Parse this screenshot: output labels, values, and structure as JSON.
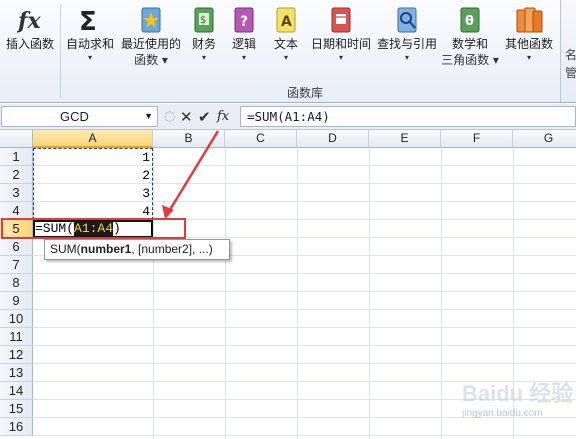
{
  "ribbon": {
    "buttons": [
      {
        "line1": "插入函数",
        "line2": "",
        "icon": "insert-function-icon"
      },
      {
        "line1": "自动求和",
        "line2": "▾",
        "icon": "sigma-icon"
      },
      {
        "line1": "最近使用的",
        "line2": "函数 ▾",
        "icon": "star-book-icon"
      },
      {
        "line1": "财务",
        "line2": "▾",
        "icon": "finance-book-icon"
      },
      {
        "line1": "逻辑",
        "line2": "▾",
        "icon": "logic-book-icon"
      },
      {
        "line1": "文本",
        "line2": "▾",
        "icon": "text-book-icon"
      },
      {
        "line1": "日期和时间",
        "line2": "▾",
        "icon": "calendar-book-icon"
      },
      {
        "line1": "查找与引用",
        "line2": "▾",
        "icon": "lookup-book-icon"
      },
      {
        "line1": "数学和",
        "line2": "三角函数 ▾",
        "icon": "math-book-icon"
      },
      {
        "line1": "其他函数",
        "line2": "▾",
        "icon": "more-functions-icon"
      }
    ],
    "group_label": "函数库",
    "cut_label_1": "名",
    "cut_label_2": "管"
  },
  "formula_bar": {
    "name_box": "GCD",
    "cancel": "✕",
    "enter": "✔",
    "fx": "fx",
    "formula": "=SUM(A1:A4)"
  },
  "grid": {
    "columns": [
      "A",
      "B",
      "C",
      "D",
      "E",
      "F",
      "G"
    ],
    "rows": [
      "1",
      "2",
      "3",
      "4",
      "5",
      "6",
      "7",
      "8",
      "9",
      "10",
      "11",
      "12",
      "13",
      "14",
      "15",
      "16"
    ],
    "cells": {
      "A1": "1",
      "A2": "2",
      "A3": "3",
      "A4": "4"
    },
    "edit_cell": {
      "prefix": "=SUM(",
      "ref": "A1:A4",
      "suffix": ")"
    },
    "active_column": "A",
    "active_row": "5"
  },
  "tooltip": {
    "func": "SUM(",
    "arg1": "number1",
    "rest": ", [number2], ...)"
  },
  "watermark": {
    "brand": "Baidu 经验",
    "url": "jingyan.baidu.com"
  },
  "colors": {
    "annotation": "#e03c3c",
    "highlight_text": "#f7d34b",
    "active_header": "#f9d578"
  }
}
